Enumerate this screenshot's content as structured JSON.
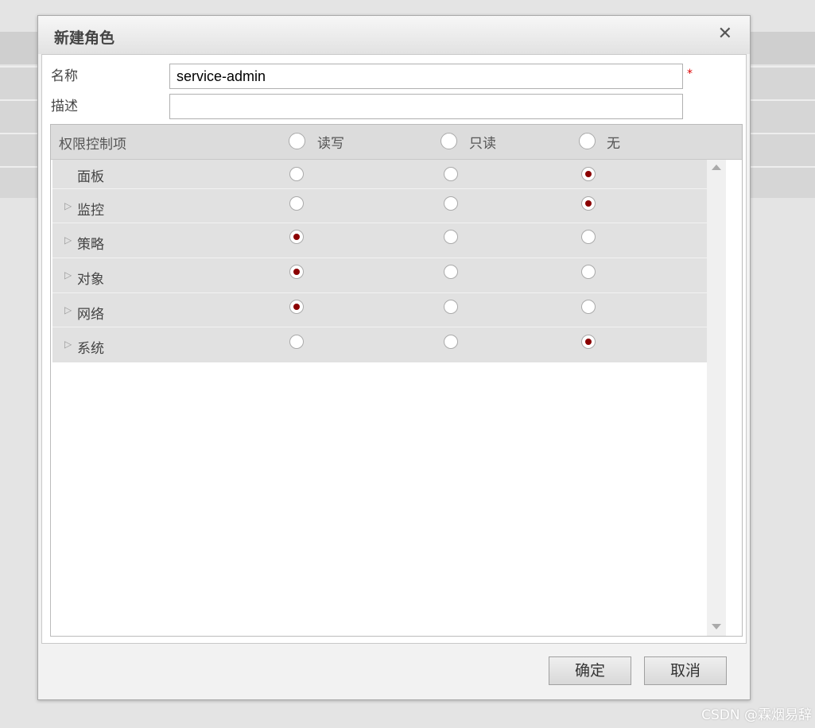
{
  "dialog": {
    "title": "新建角色",
    "close_symbol": "✕"
  },
  "form": {
    "name_label": "名称",
    "name_value": "service-admin",
    "required_mark": "*",
    "desc_label": "描述",
    "desc_value": ""
  },
  "permissions": {
    "header_label": "权限控制项",
    "options": [
      "读写",
      "只读",
      "无"
    ],
    "rows": [
      {
        "label": "面板",
        "expandable": false,
        "selected": 2
      },
      {
        "label": "监控",
        "expandable": true,
        "selected": 2
      },
      {
        "label": "策略",
        "expandable": true,
        "selected": 0
      },
      {
        "label": "对象",
        "expandable": true,
        "selected": 0
      },
      {
        "label": "网络",
        "expandable": true,
        "selected": 0
      },
      {
        "label": "系统",
        "expandable": true,
        "selected": 2
      }
    ]
  },
  "footer": {
    "ok_label": "确定",
    "cancel_label": "取消"
  },
  "watermark": "CSDN @霖烟易辞",
  "colors": {
    "accent_radio": "#8b0000",
    "required": "#dd0000"
  },
  "icons": {
    "expand": "triangle-right-icon",
    "close": "close-icon"
  }
}
